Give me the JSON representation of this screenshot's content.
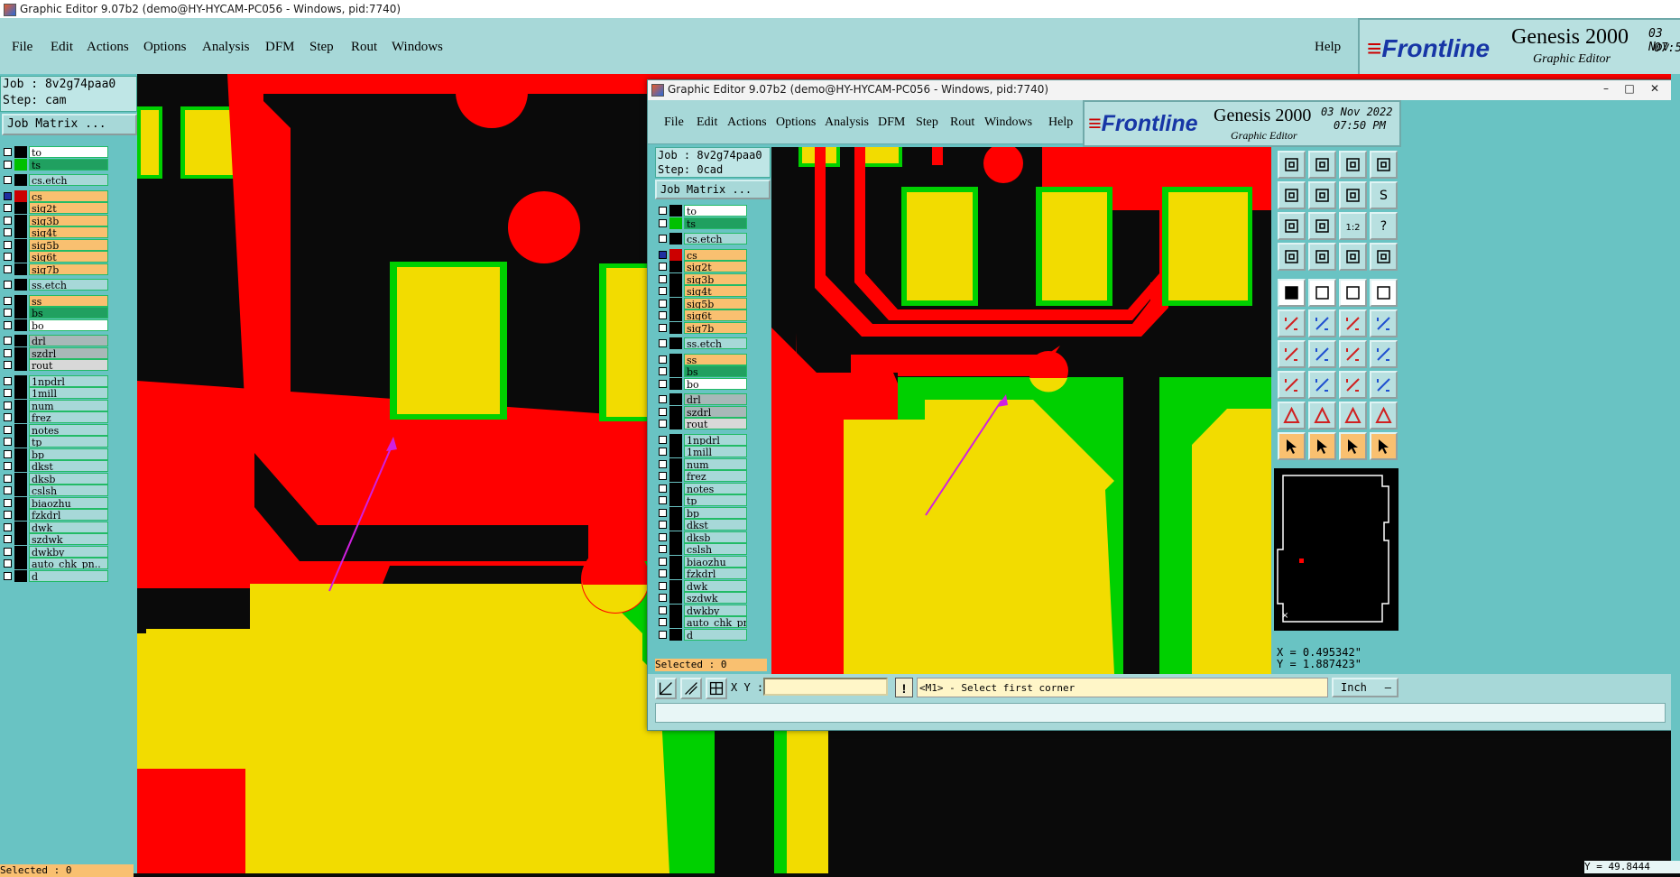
{
  "colors": {
    "red": "#ff0000",
    "yellow": "#f2dc00",
    "green": "#00d000",
    "black": "#0a0a0a",
    "panel": "#69c3c3",
    "menubar": "#a7d8d8"
  },
  "main_window": {
    "title": "Graphic Editor 9.07b2 (demo@HY-HYCAM-PC056 - Windows, pid:7740)",
    "menu": [
      "File",
      "Edit",
      "Actions",
      "Options",
      "Analysis",
      "DFM",
      "Step",
      "Rout",
      "Windows"
    ],
    "help": "Help",
    "brand": {
      "logo": "Frontline",
      "product": "Genesis 2000",
      "subtitle": "Graphic Editor",
      "date": "03 Nov",
      "time": "07:5"
    },
    "job": "Job : 8v2g74paa0",
    "step": "Step: cam",
    "job_matrix": "Job Matrix ...",
    "selected": "Selected : 0",
    "coord_fragment": "Y = 49.8444"
  },
  "front_window": {
    "title": "Graphic Editor 9.07b2 (demo@HY-HYCAM-PC056 - Windows, pid:7740)",
    "menu": [
      "File",
      "Edit",
      "Actions",
      "Options",
      "Analysis",
      "DFM",
      "Step",
      "Rout",
      "Windows"
    ],
    "help": "Help",
    "brand": {
      "logo": "Frontline",
      "product": "Genesis 2000",
      "subtitle": "Graphic Editor",
      "date": "03 Nov 2022",
      "time": "07:50 PM"
    },
    "job": "Job : 8v2g74paa0",
    "step": "Step: 0cad",
    "job_matrix": "Job Matrix ...",
    "selected": "Selected : 0",
    "coords": {
      "x": "X = 0.495342\"",
      "y": "Y = 1.887423\""
    },
    "xy_label": "X Y :",
    "xy_value": "",
    "prompt": "<M1> - Select first corner",
    "units": "Inch"
  },
  "layers": [
    {
      "name": "to",
      "sw": "#000",
      "bg": "#ffffff"
    },
    {
      "name": "ts",
      "sw": "#00c000",
      "bg": "#20a060"
    },
    {
      "name": "cs.etch",
      "sw": "#000",
      "bg": "#a7d8d8",
      "gap": true
    },
    {
      "name": "cs",
      "sw": "#cc0000",
      "bg": "#f9c070",
      "cbsel": true,
      "gap": true
    },
    {
      "name": "sig2t",
      "sw": "#000",
      "bg": "#f9c070"
    },
    {
      "name": "sig3b",
      "sw": "#000",
      "bg": "#f9c070"
    },
    {
      "name": "sig4t",
      "sw": "#000",
      "bg": "#f9c070"
    },
    {
      "name": "sig5b",
      "sw": "#000",
      "bg": "#f9c070"
    },
    {
      "name": "sig6t",
      "sw": "#000",
      "bg": "#f9c070"
    },
    {
      "name": "sig7b",
      "sw": "#000",
      "bg": "#f9c070"
    },
    {
      "name": "ss.etch",
      "sw": "#000",
      "bg": "#a7d8d8",
      "gap": true
    },
    {
      "name": "ss",
      "sw": "#000",
      "bg": "#f9c070",
      "gap": true
    },
    {
      "name": "bs",
      "sw": "#000",
      "bg": "#20a060"
    },
    {
      "name": "bo",
      "sw": "#000",
      "bg": "#ffffff"
    },
    {
      "name": "drl",
      "sw": "#000",
      "bg": "#a8b8b8",
      "gap": true
    },
    {
      "name": "szdrl",
      "sw": "#000",
      "bg": "#a8b8b8"
    },
    {
      "name": "rout",
      "sw": "#000",
      "bg": "#d8d8d8"
    },
    {
      "name": "1npdrl",
      "sw": "#000",
      "bg": "#a7d8d8",
      "gap": true
    },
    {
      "name": "1mill",
      "sw": "#000",
      "bg": "#a7d8d8"
    },
    {
      "name": "num",
      "sw": "#000",
      "bg": "#a7d8d8"
    },
    {
      "name": "frez",
      "sw": "#000",
      "bg": "#a7d8d8"
    },
    {
      "name": "notes",
      "sw": "#000",
      "bg": "#a7d8d8"
    },
    {
      "name": "tp",
      "sw": "#000",
      "bg": "#a7d8d8"
    },
    {
      "name": "bp",
      "sw": "#000",
      "bg": "#a7d8d8"
    },
    {
      "name": "dkst",
      "sw": "#000",
      "bg": "#a7d8d8"
    },
    {
      "name": "dksb",
      "sw": "#000",
      "bg": "#a7d8d8"
    },
    {
      "name": "cslsh",
      "sw": "#000",
      "bg": "#a7d8d8"
    },
    {
      "name": "biaozhu",
      "sw": "#000",
      "bg": "#a7d8d8"
    },
    {
      "name": "fzkdrl",
      "sw": "#000",
      "bg": "#a7d8d8"
    },
    {
      "name": "dwk",
      "sw": "#000",
      "bg": "#a7d8d8"
    },
    {
      "name": "szdwk",
      "sw": "#000",
      "bg": "#a7d8d8"
    },
    {
      "name": "dwkby",
      "sw": "#000",
      "bg": "#a7d8d8"
    },
    {
      "name": "auto_chk_pn..",
      "sw": "#000",
      "bg": "#a7d8d8"
    },
    {
      "name": "d",
      "sw": "#000",
      "bg": "#a7d8d8"
    }
  ],
  "tools": [
    "move-up-icon",
    "move-down-icon",
    "home-icon",
    "window-icon",
    "pan-left-icon",
    "pan-right-icon",
    "zoom-back-icon",
    "zoom-s-icon",
    "zoom-fit-icon",
    "zoom-center-icon",
    "scale-1-2-icon",
    "help-icon",
    "filter-icon",
    "grid-icon",
    "measure-pad-icon",
    "measure-drill-icon",
    "select-pad-icon",
    "copy-icon",
    "ruler-icon",
    "dot-icon",
    "net-icon",
    "cross-icon",
    "route-line-icon",
    "route-end-icon",
    "angle-icon",
    "line-icon",
    "arc-icon",
    "bracket-icon",
    "pad-move-icon",
    "segment-icon",
    "ruler-box-icon",
    "pad-blue-icon",
    "triangle-1-icon",
    "triangle-2-icon",
    "triangle-3-icon",
    "triangle-4-icon",
    "pointer-icon",
    "pointer-fill-icon",
    "pointer-cross-icon",
    "pointer-move-icon"
  ]
}
